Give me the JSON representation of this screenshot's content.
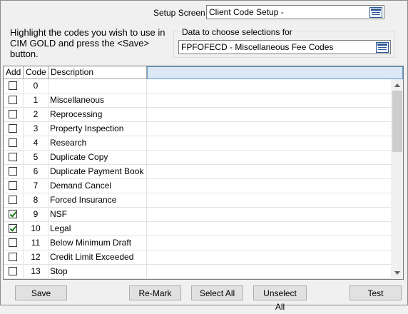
{
  "header": {
    "setup_screen_label": "Setup Screen",
    "setup_screen_value": "Client Code Setup -",
    "instructions": "Highlight the codes you wish to use in CIM GOLD and press the <Save> button.",
    "data_group_label": "Data to choose selections for",
    "data_value": "FPFOFECD - Miscellaneous Fee Codes"
  },
  "grid": {
    "columns": [
      "Add",
      "Code",
      "Description",
      ""
    ],
    "rows": [
      {
        "checked": false,
        "code": "0",
        "description": ""
      },
      {
        "checked": false,
        "code": "1",
        "description": "Miscellaneous"
      },
      {
        "checked": false,
        "code": "2",
        "description": "Reprocessing"
      },
      {
        "checked": false,
        "code": "3",
        "description": "Property Inspection"
      },
      {
        "checked": false,
        "code": "4",
        "description": "Research"
      },
      {
        "checked": false,
        "code": "5",
        "description": "Duplicate Copy"
      },
      {
        "checked": false,
        "code": "6",
        "description": "Duplicate Payment Book"
      },
      {
        "checked": false,
        "code": "7",
        "description": "Demand Cancel"
      },
      {
        "checked": false,
        "code": "8",
        "description": "Forced Insurance"
      },
      {
        "checked": true,
        "code": "9",
        "description": "NSF"
      },
      {
        "checked": true,
        "code": "10",
        "description": "Legal"
      },
      {
        "checked": false,
        "code": "11",
        "description": "Below Minimum Draft"
      },
      {
        "checked": false,
        "code": "12",
        "description": "Credit Limit Exceeded"
      },
      {
        "checked": false,
        "code": "13",
        "description": "Stop"
      }
    ]
  },
  "buttons": {
    "save": "Save",
    "remark": "Re-Mark",
    "select_all": "Select All",
    "unselect_all": "Unselect All",
    "test": "Test"
  }
}
